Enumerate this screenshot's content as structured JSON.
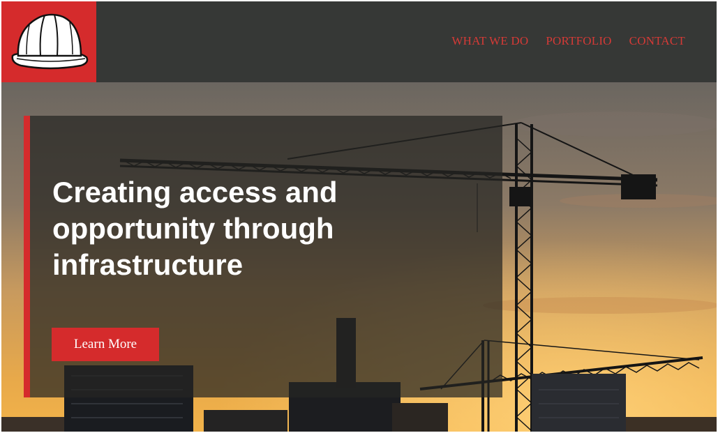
{
  "brand": {
    "logo": "hard-hat-icon",
    "accent": "#d52b2c",
    "header_bg": "#363836"
  },
  "nav": {
    "items": [
      {
        "label": "WHAT WE DO"
      },
      {
        "label": "PORTFOLIO"
      },
      {
        "label": "CONTACT"
      }
    ],
    "color": "#d53a36"
  },
  "hero": {
    "headline": "Creating access and opportunity through infrastructure",
    "cta_label": "Learn More",
    "image": "construction-cranes-sunset"
  }
}
